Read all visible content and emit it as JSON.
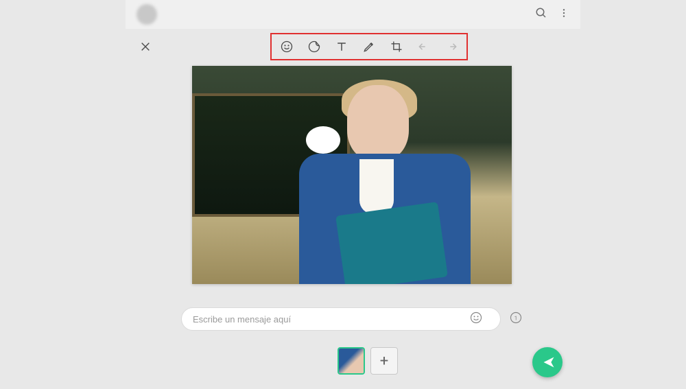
{
  "header": {
    "contact_name": "      "
  },
  "toolbar": {
    "items": [
      {
        "name": "emoji-icon",
        "interactable": true
      },
      {
        "name": "sticker-icon",
        "interactable": true
      },
      {
        "name": "text-icon",
        "interactable": true
      },
      {
        "name": "draw-icon",
        "interactable": true
      },
      {
        "name": "crop-icon",
        "interactable": true
      },
      {
        "name": "undo-icon",
        "interactable": false
      },
      {
        "name": "redo-icon",
        "interactable": false
      }
    ]
  },
  "caption": {
    "placeholder": "Escribe un mensaje aquí",
    "value": ""
  },
  "thumbs": {
    "add_label": "+"
  },
  "colors": {
    "accent": "#2ac88a",
    "highlight_border": "#e03030"
  }
}
